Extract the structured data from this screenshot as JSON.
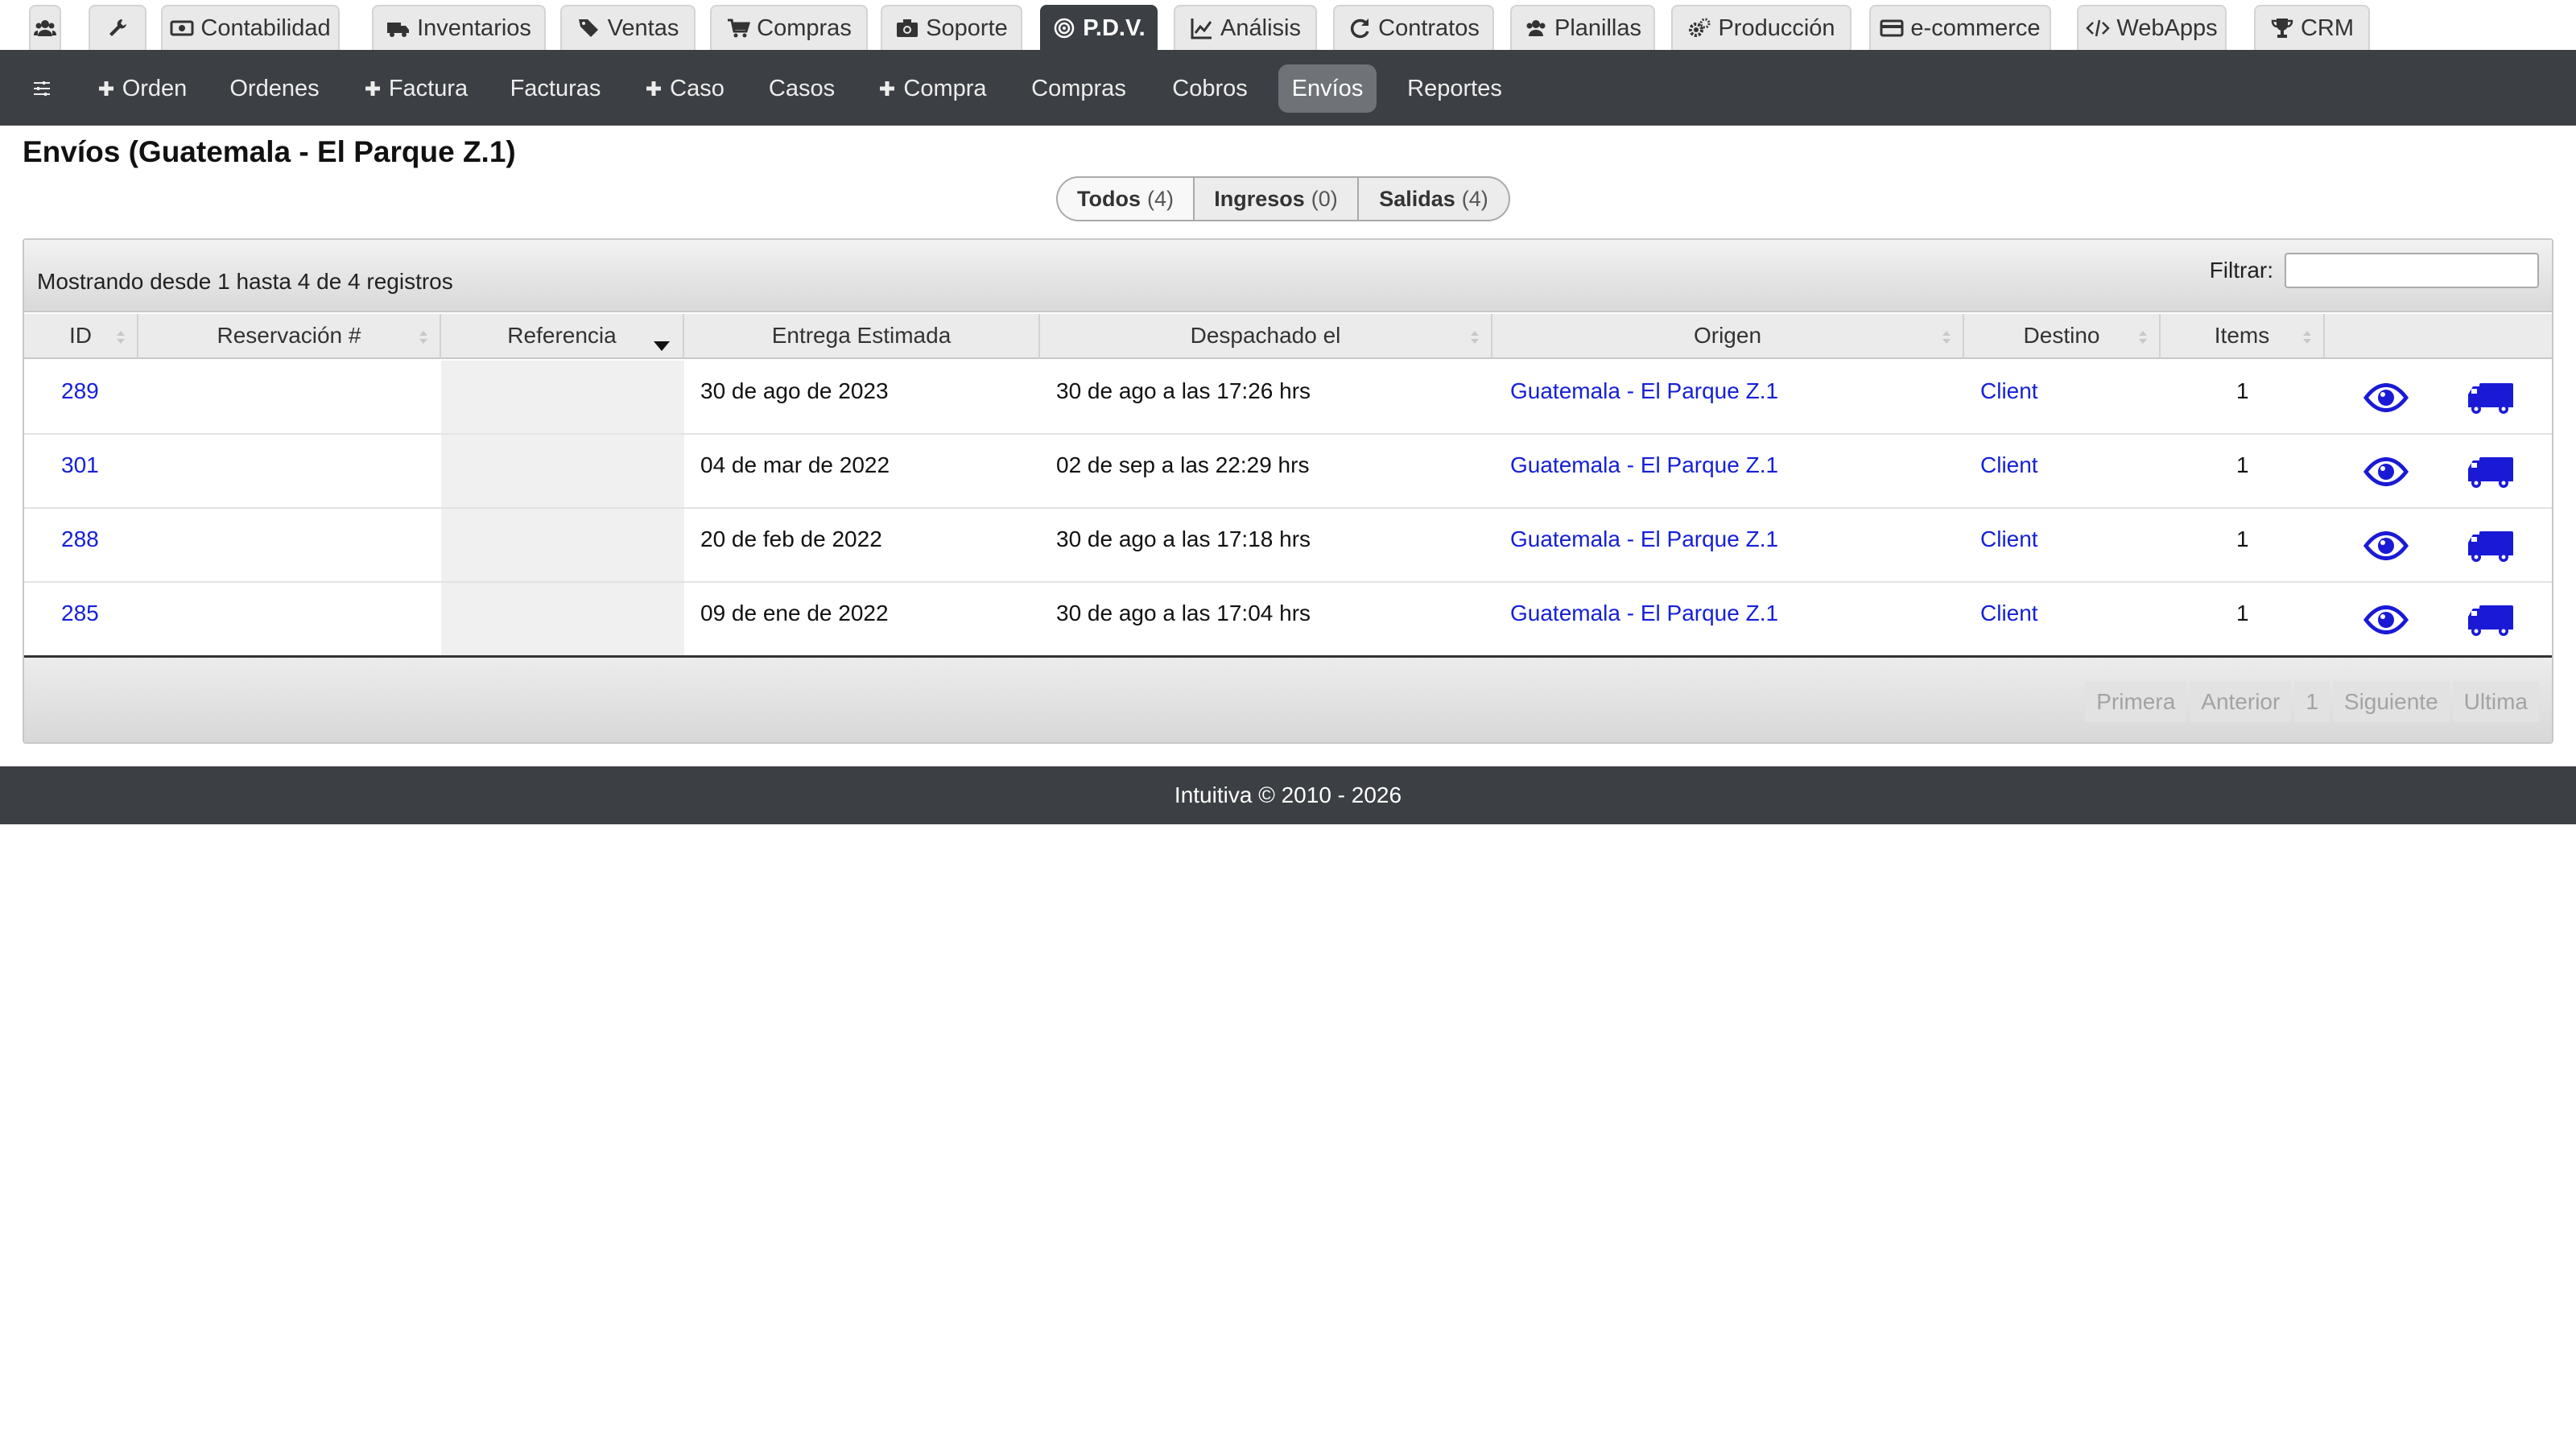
{
  "top_tabs": [
    {
      "label": "",
      "icon": "users-icon"
    },
    {
      "label": "",
      "icon": "wrench-icon"
    },
    {
      "label": "Contabilidad",
      "icon": "money-icon"
    },
    {
      "label": "Inventarios",
      "icon": "truck-icon"
    },
    {
      "label": "Ventas",
      "icon": "tags-icon"
    },
    {
      "label": "Compras",
      "icon": "cart-icon"
    },
    {
      "label": "Soporte",
      "icon": "camera-icon"
    },
    {
      "label": "P.D.V.",
      "icon": "target-icon",
      "active": true
    },
    {
      "label": "Análisis",
      "icon": "line-chart-icon"
    },
    {
      "label": "Contratos",
      "icon": "refresh-icon"
    },
    {
      "label": "Planillas",
      "icon": "users-icon"
    },
    {
      "label": "Producción",
      "icon": "gears-icon"
    },
    {
      "label": "e-commerce",
      "icon": "credit-card-icon"
    },
    {
      "label": "WebApps",
      "icon": "code-icon"
    },
    {
      "label": "CRM",
      "icon": "trophy-icon"
    }
  ],
  "sub_nav": [
    {
      "label": "",
      "icon": "sliders-icon"
    },
    {
      "label": "Orden",
      "icon": "plus-icon"
    },
    {
      "label": "Ordenes"
    },
    {
      "label": "Factura",
      "icon": "plus-icon"
    },
    {
      "label": "Facturas"
    },
    {
      "label": "Caso",
      "icon": "plus-icon"
    },
    {
      "label": "Casos"
    },
    {
      "label": "Compra",
      "icon": "plus-icon"
    },
    {
      "label": "Compras"
    },
    {
      "label": "Cobros"
    },
    {
      "label": "Envíos",
      "active": true
    },
    {
      "label": "Reportes"
    }
  ],
  "page": {
    "title": "Envíos (Guatemala - El Parque Z.1)"
  },
  "segments": [
    {
      "label": "Todos",
      "count": "(4)",
      "active": true
    },
    {
      "label": "Ingresos",
      "count": "(0)"
    },
    {
      "label": "Salidas",
      "count": "(4)"
    }
  ],
  "table": {
    "showing": "Mostrando desde 1 hasta 4 de 4 registros",
    "filter_label": "Filtrar:",
    "filter_value": "",
    "columns": [
      "ID",
      "Reservación #",
      "Referencia",
      "Entrega Estimada",
      "Despachado el",
      "Origen",
      "Destino",
      "Items",
      ""
    ],
    "rows": [
      {
        "id": "289",
        "reservation": "",
        "reference": "",
        "estimated": "30 de ago de 2023",
        "dispatched": "30 de ago a las 17:26 hrs",
        "origin": "Guatemala - El Parque Z.1",
        "destination": "Client",
        "items": "1"
      },
      {
        "id": "301",
        "reservation": "",
        "reference": "",
        "estimated": "04 de mar de 2022",
        "dispatched": "02 de sep a las 22:29 hrs",
        "origin": "Guatemala - El Parque Z.1",
        "destination": "Client",
        "items": "1"
      },
      {
        "id": "288",
        "reservation": "",
        "reference": "",
        "estimated": "20 de feb de 2022",
        "dispatched": "30 de ago a las 17:18 hrs",
        "origin": "Guatemala - El Parque Z.1",
        "destination": "Client",
        "items": "1"
      },
      {
        "id": "285",
        "reservation": "",
        "reference": "",
        "estimated": "09 de ene de 2022",
        "dispatched": "30 de ago a las 17:04 hrs",
        "origin": "Guatemala - El Parque Z.1",
        "destination": "Client",
        "items": "1"
      }
    ],
    "row_actions": [
      "eye-icon",
      "truck-icon"
    ]
  },
  "pager": {
    "first": "Primera",
    "prev": "Anterior",
    "page": "1",
    "next": "Siguiente",
    "last": "Ultima"
  },
  "footer": {
    "text": "Intuitiva © 2010 - 2026"
  },
  "colors": {
    "toolbar_bg": "#3c3f43",
    "link": "#1620d6",
    "icon_blue": "#1a1ad6"
  }
}
